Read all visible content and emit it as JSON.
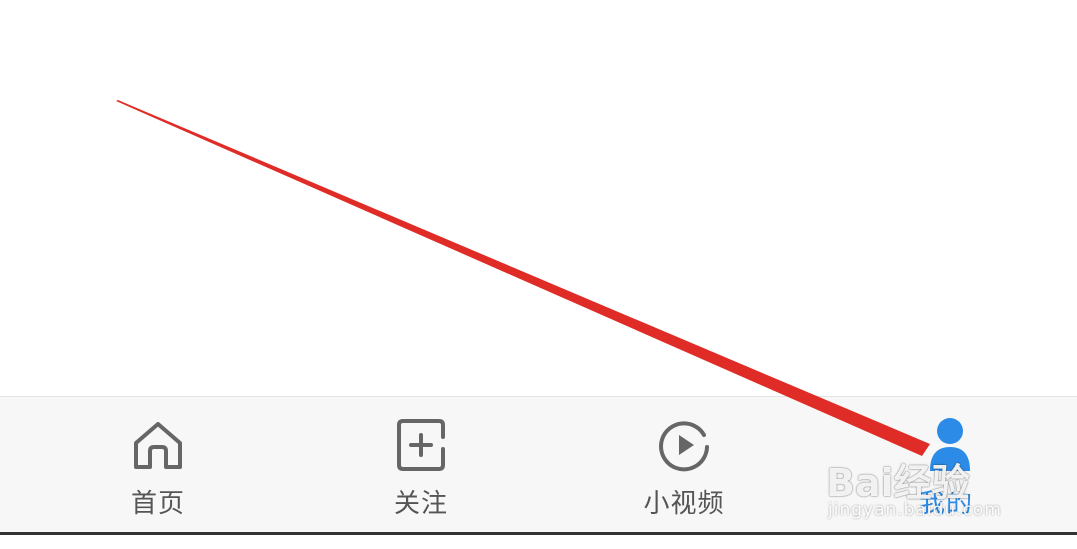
{
  "tabbar": {
    "tabs": [
      {
        "id": "home",
        "label": "首页",
        "icon": "home-icon",
        "active": false
      },
      {
        "id": "follow",
        "label": "关注",
        "icon": "plus-square-icon",
        "active": false
      },
      {
        "id": "video",
        "label": "小视频",
        "icon": "play-circle-icon",
        "active": false
      },
      {
        "id": "mine",
        "label": "我的",
        "icon": "user-icon",
        "active": true
      }
    ],
    "active_color": "#2b8be6",
    "inactive_color": "#555555"
  },
  "annotation": {
    "arrow_color": "#e02c27"
  },
  "watermark": {
    "main": "Bai经验",
    "sub": "jingyan.baidu.com"
  }
}
